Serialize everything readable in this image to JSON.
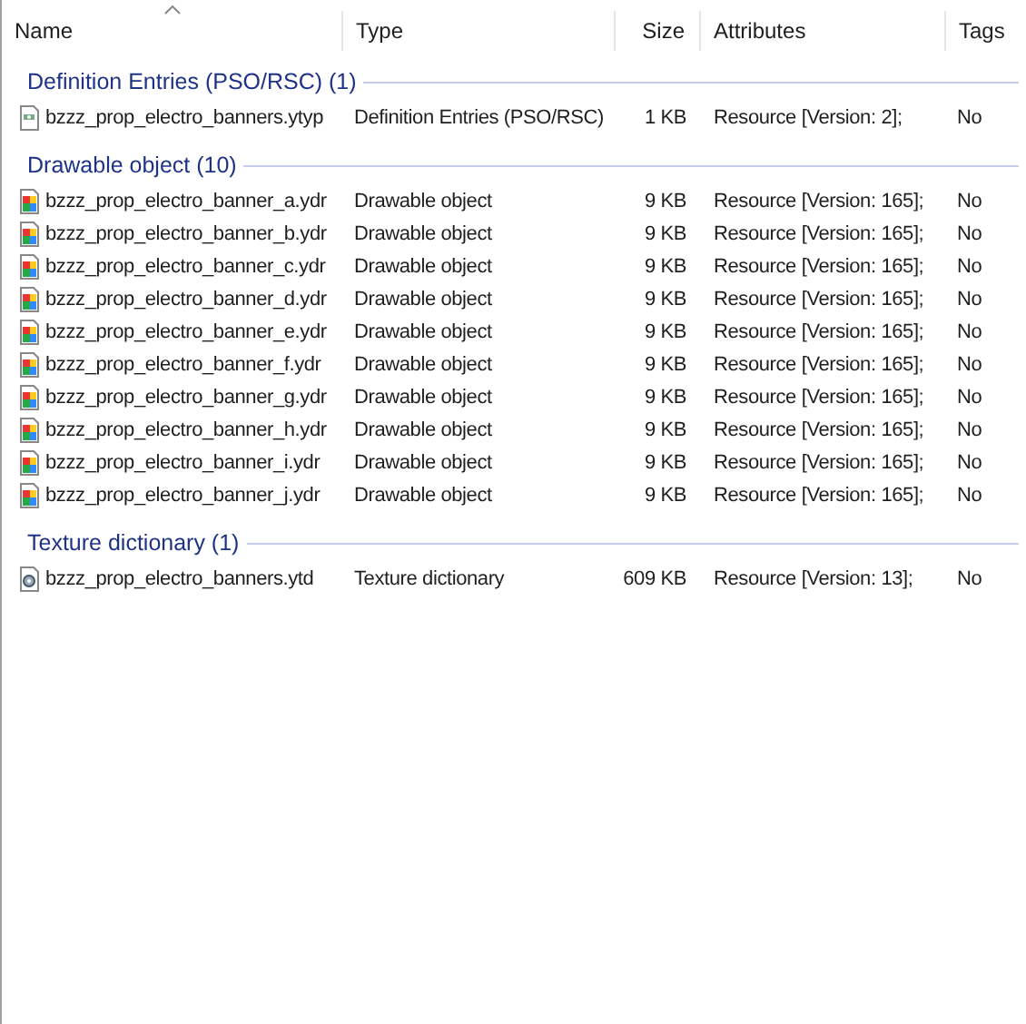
{
  "columns": [
    {
      "label": "Name",
      "sorted": true
    },
    {
      "label": "Type",
      "sorted": false
    },
    {
      "label": "Size",
      "sorted": false
    },
    {
      "label": "Attributes",
      "sorted": false
    },
    {
      "label": "Tags",
      "sorted": false
    }
  ],
  "groups": [
    {
      "title": "Definition Entries (PSO/RSC) (1)",
      "items": [
        {
          "kind": "definition",
          "name": "bzzz_prop_electro_banners.ytyp",
          "type": "Definition Entries (PSO/RSC)",
          "size": "1 KB",
          "attributes": "Resource [Version: 2];",
          "tags": "No"
        }
      ]
    },
    {
      "title": "Drawable object (10)",
      "items": [
        {
          "kind": "drawable",
          "name": "bzzz_prop_electro_banner_a.ydr",
          "type": "Drawable object",
          "size": "9 KB",
          "attributes": "Resource [Version: 165];",
          "tags": "No"
        },
        {
          "kind": "drawable",
          "name": "bzzz_prop_electro_banner_b.ydr",
          "type": "Drawable object",
          "size": "9 KB",
          "attributes": "Resource [Version: 165];",
          "tags": "No"
        },
        {
          "kind": "drawable",
          "name": "bzzz_prop_electro_banner_c.ydr",
          "type": "Drawable object",
          "size": "9 KB",
          "attributes": "Resource [Version: 165];",
          "tags": "No"
        },
        {
          "kind": "drawable",
          "name": "bzzz_prop_electro_banner_d.ydr",
          "type": "Drawable object",
          "size": "9 KB",
          "attributes": "Resource [Version: 165];",
          "tags": "No"
        },
        {
          "kind": "drawable",
          "name": "bzzz_prop_electro_banner_e.ydr",
          "type": "Drawable object",
          "size": "9 KB",
          "attributes": "Resource [Version: 165];",
          "tags": "No"
        },
        {
          "kind": "drawable",
          "name": "bzzz_prop_electro_banner_f.ydr",
          "type": "Drawable object",
          "size": "9 KB",
          "attributes": "Resource [Version: 165];",
          "tags": "No"
        },
        {
          "kind": "drawable",
          "name": "bzzz_prop_electro_banner_g.ydr",
          "type": "Drawable object",
          "size": "9 KB",
          "attributes": "Resource [Version: 165];",
          "tags": "No"
        },
        {
          "kind": "drawable",
          "name": "bzzz_prop_electro_banner_h.ydr",
          "type": "Drawable object",
          "size": "9 KB",
          "attributes": "Resource [Version: 165];",
          "tags": "No"
        },
        {
          "kind": "drawable",
          "name": "bzzz_prop_electro_banner_i.ydr",
          "type": "Drawable object",
          "size": "9 KB",
          "attributes": "Resource [Version: 165];",
          "tags": "No"
        },
        {
          "kind": "drawable",
          "name": "bzzz_prop_electro_banner_j.ydr",
          "type": "Drawable object",
          "size": "9 KB",
          "attributes": "Resource [Version: 165];",
          "tags": "No"
        }
      ]
    },
    {
      "title": "Texture dictionary (1)",
      "items": [
        {
          "kind": "texture",
          "name": "bzzz_prop_electro_banners.ytd",
          "type": "Texture dictionary",
          "size": "609 KB",
          "attributes": "Resource [Version: 13];",
          "tags": "No"
        }
      ]
    }
  ]
}
